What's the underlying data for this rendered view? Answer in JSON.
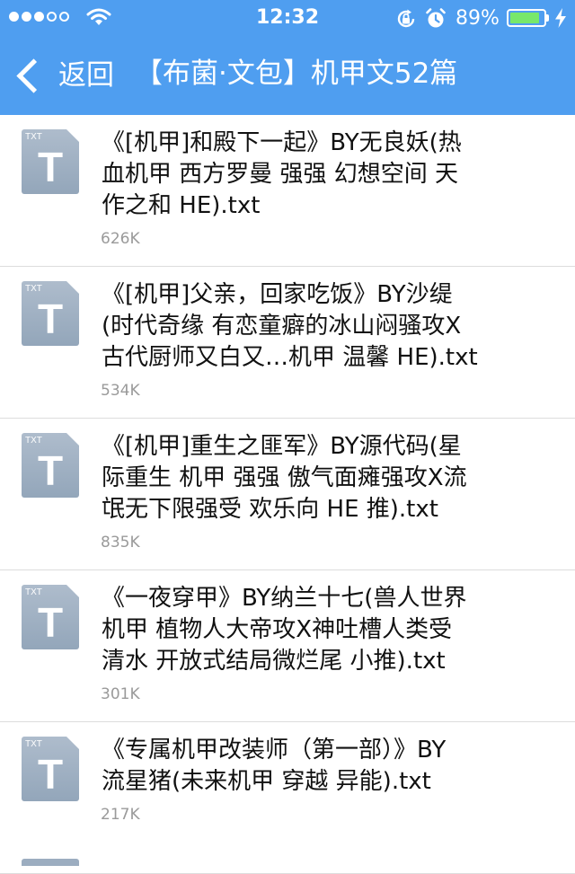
{
  "status_bar": {
    "time": "12:32",
    "battery_percent": "89%",
    "battery_level": 0.89,
    "battery_color": "#78e86a",
    "signal_bars_filled": 3,
    "signal_bars_total": 5,
    "icons": [
      "wifi-icon",
      "rotation-lock-icon",
      "alarm-icon",
      "battery-icon",
      "charging-icon"
    ]
  },
  "nav": {
    "back_label": "返回",
    "title": "【布菌·文包】机甲文52篇",
    "background_color": "#4f9ef0"
  },
  "file_icon": {
    "ext_label": "TXT",
    "letter": "T"
  },
  "files": [
    {
      "lines": [
        "《[机甲]和殿下一起》BY无良妖(热",
        "血机甲 西方罗曼 强强 幻想空间 天",
        "作之和 HE).txt"
      ],
      "size": "626K"
    },
    {
      "lines": [
        "《[机甲]父亲，回家吃饭》BY沙缇",
        "(时代奇缘 有恋童癖的冰山闷骚攻X",
        "古代厨师又白又…机甲 温馨 HE).txt"
      ],
      "size": "534K"
    },
    {
      "lines": [
        "《[机甲]重生之匪军》BY源代码(星",
        "际重生 机甲 强强 傲气面瘫强攻X流",
        "氓无下限强受 欢乐向 HE 推).txt"
      ],
      "size": "835K"
    },
    {
      "lines": [
        "《一夜穿甲》BY纳兰十七(兽人世界",
        "机甲 植物人大帝攻X神吐槽人类受",
        "清水 开放式结局微烂尾 小推).txt"
      ],
      "size": "301K"
    },
    {
      "lines": [
        "《专属机甲改装师（第一部）》BY",
        "流星猪(未来机甲 穿越 异能).txt"
      ],
      "size": "217K"
    }
  ]
}
